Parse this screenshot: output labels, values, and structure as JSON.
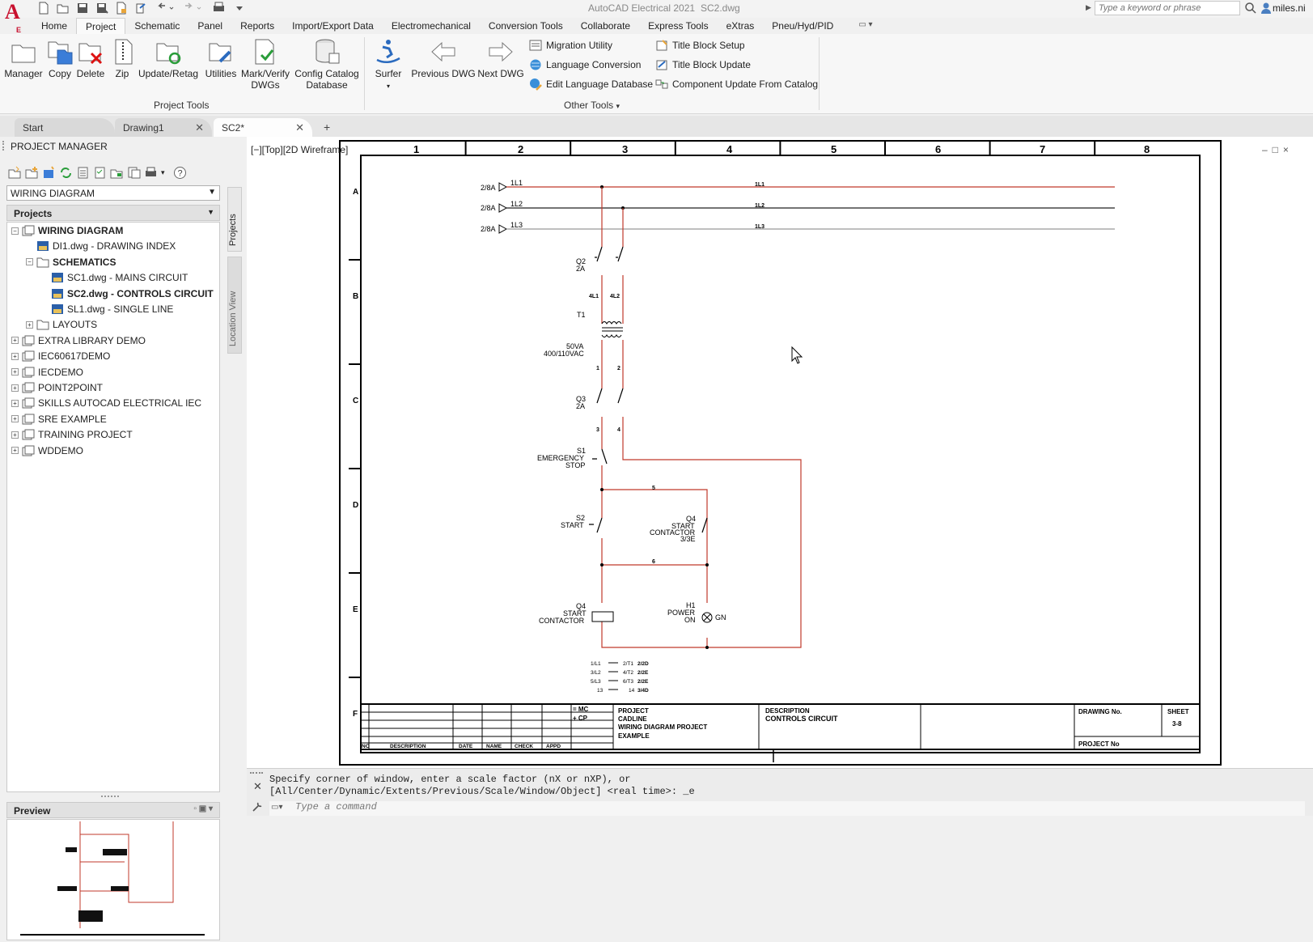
{
  "app": {
    "logo_letter": "A",
    "logo_sub": "E",
    "title": "AutoCAD Electrical 2021",
    "file": "SC2.dwg",
    "search_placeholder": "Type a keyword or phrase",
    "user": "miles.ni"
  },
  "ribbon_tabs": [
    "Home",
    "Project",
    "Schematic",
    "Panel",
    "Reports",
    "Import/Export Data",
    "Electromechanical",
    "Conversion Tools",
    "Collaborate",
    "Express Tools",
    "eXtras",
    "Pneu/Hyd/PID"
  ],
  "ribbon": {
    "project_tools": {
      "label": "Project Tools",
      "buttons": [
        "Manager",
        "Copy",
        "Delete",
        "Zip",
        "Update/Retag",
        "Utilities",
        "Mark/Verify",
        "DWGs",
        "Config Catalog",
        "Database"
      ]
    },
    "other_tools": {
      "label": "Other Tools",
      "buttons": [
        "Surfer",
        "Previous DWG",
        "Next DWG"
      ],
      "small": [
        "Migration Utility",
        "Language Conversion",
        "Edit Language Database",
        "Title Block Setup",
        "Title Block Update",
        "Component Update From Catalog"
      ]
    }
  },
  "doc_tabs": [
    "Start",
    "Drawing1",
    "SC2*"
  ],
  "project_manager": {
    "title": "PROJECT MANAGER",
    "selected_project": "WIRING DIAGRAM",
    "projects_header": "Projects",
    "tree": [
      "WIRING DIAGRAM",
      "DI1.dwg - DRAWING INDEX",
      "SCHEMATICS",
      "SC1.dwg - MAINS CIRCUIT",
      "SC2.dwg - CONTROLS CIRCUIT",
      "SL1.dwg - SINGLE LINE",
      "LAYOUTS",
      "EXTRA LIBRARY DEMO",
      "IEC60617DEMO",
      "IECDEMO",
      "POINT2POINT",
      "SKILLS AUTOCAD ELECTRICAL IEC",
      "SRE EXAMPLE",
      "TRAINING PROJECT",
      "WDDEMO"
    ],
    "side_tabs": [
      "Projects",
      "Location View"
    ],
    "preview_header": "Preview"
  },
  "viewport": {
    "label": "[−][Top][2D Wireframe]",
    "controls": "–□×"
  },
  "drawing": {
    "columns": [
      "1",
      "2",
      "3",
      "4",
      "5",
      "6",
      "7",
      "8"
    ],
    "rows": [
      "A",
      "B",
      "C",
      "D",
      "E",
      "F"
    ],
    "refs": [
      "2/8A",
      "2/8A",
      "2/8A"
    ],
    "lines": [
      "1L1",
      "1L2",
      "1L3"
    ],
    "q2": [
      "Q2",
      "2A"
    ],
    "wire_4l": [
      "4L1",
      "4L2"
    ],
    "t1": "T1",
    "transformer": [
      "50VA",
      "400/110VAC"
    ],
    "q3": [
      "Q3",
      "2A"
    ],
    "s1": [
      "S1",
      "EMERGENCY",
      "STOP"
    ],
    "s2": [
      "S2",
      "START"
    ],
    "q4_contact": [
      "Q4",
      "START",
      "CONTACTOR",
      "3/3E"
    ],
    "q4_coil": [
      "Q4",
      "START",
      "CONTACTOR"
    ],
    "h1": [
      "H1",
      "POWER",
      "ON",
      "GN"
    ],
    "wire_nums": [
      "1",
      "2",
      "3",
      "4",
      "5",
      "6"
    ],
    "contacts_table": [
      "1/L1",
      "2/T1",
      "2/2D",
      "3/L2",
      "4/T2",
      "2/2E",
      "5/L3",
      "6/T3",
      "2/2E",
      "13",
      "14",
      "3/4D"
    ],
    "title_block": {
      "mc": "= MC",
      "cp": "+ CP",
      "project_label": "PROJECT",
      "project_lines": [
        "CADLINE",
        "WIRING DIAGRAM PROJECT",
        "EXAMPLE"
      ],
      "desc_label": "DESCRIPTION",
      "desc_value": "CONTROLS CIRCUIT",
      "drawing_no": "DRAWING No.",
      "sheet": "SHEET",
      "sheet_val": "3-8",
      "project_no": "PROJECT No",
      "footer": [
        "NO",
        "DESCRIPTION",
        "DATE",
        "NAME",
        "CHECK",
        "APPD"
      ]
    }
  },
  "command": {
    "line1": "Specify corner of window, enter a scale factor (nX or nXP), or",
    "line2": "[All/Center/Dynamic/Extents/Previous/Scale/Window/Object] <real time>: _e",
    "placeholder": "Type a command"
  },
  "colors": {
    "wire": "#c0392b",
    "accent": "#c8102e",
    "frame": "#000000"
  }
}
